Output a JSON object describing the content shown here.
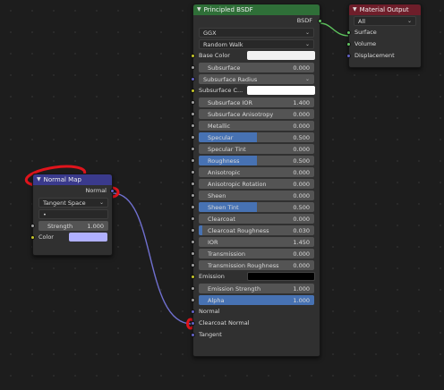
{
  "principled": {
    "title": "Principled BSDF",
    "output_label": "BSDF",
    "distribution": "GGX",
    "subsurface_method": "Random Walk",
    "base_color_label": "Base Color",
    "subsurface": {
      "label": "Subsurface",
      "value": "0.000"
    },
    "subsurface_radius": "Subsurface Radius",
    "subsurface_color_label": "Subsurface C...",
    "params": [
      {
        "label": "Subsurface IOR",
        "value": "1.400",
        "fill": 0.0
      },
      {
        "label": "Subsurface Anisotropy",
        "value": "0.000",
        "fill": 0.0
      },
      {
        "label": "Metallic",
        "value": "0.000",
        "fill": 0.0
      },
      {
        "label": "Specular",
        "value": "0.500",
        "fill": 0.5
      },
      {
        "label": "Specular Tint",
        "value": "0.000",
        "fill": 0.0
      },
      {
        "label": "Roughness",
        "value": "0.500",
        "fill": 0.5
      },
      {
        "label": "Anisotropic",
        "value": "0.000",
        "fill": 0.0
      },
      {
        "label": "Anisotropic Rotation",
        "value": "0.000",
        "fill": 0.0
      },
      {
        "label": "Sheen",
        "value": "0.000",
        "fill": 0.0
      },
      {
        "label": "Sheen Tint",
        "value": "0.500",
        "fill": 0.5
      },
      {
        "label": "Clearcoat",
        "value": "0.000",
        "fill": 0.0
      },
      {
        "label": "Clearcoat Roughness",
        "value": "0.030",
        "fill": 0.03
      },
      {
        "label": "IOR",
        "value": "1.450",
        "fill": 0.0
      },
      {
        "label": "Transmission",
        "value": "0.000",
        "fill": 0.0
      },
      {
        "label": "Transmission Roughness",
        "value": "0.000",
        "fill": 0.0
      }
    ],
    "emission_label": "Emission",
    "emission_strength": {
      "label": "Emission Strength",
      "value": "1.000"
    },
    "alpha": {
      "label": "Alpha",
      "value": "1.000",
      "fill": 1.0
    },
    "normal_label": "Normal",
    "clearcoat_normal_label": "Clearcoat Normal",
    "tangent_label": "Tangent"
  },
  "material_output": {
    "title": "Material Output",
    "target": "All",
    "inputs": [
      "Surface",
      "Volume",
      "Displacement"
    ]
  },
  "normal_map": {
    "title": "Normal Map",
    "output_label": "Normal",
    "space": "Tangent Space",
    "uv_map": "•",
    "strength": {
      "label": "Strength",
      "value": "1.000"
    },
    "color_label": "Color"
  },
  "colors": {
    "shader_header": "#2f6f38",
    "output_header": "#6e1e2a",
    "vector_header": "#3a3a8c",
    "base_color": "#f2f2f2",
    "subsurface_color": "#ffffff",
    "emission_color": "#000000",
    "normal_map_color": "#b0b0ff",
    "annotation": "#e0141c",
    "wire_vector": "#7070d0",
    "wire_shader": "#5ec45e"
  }
}
